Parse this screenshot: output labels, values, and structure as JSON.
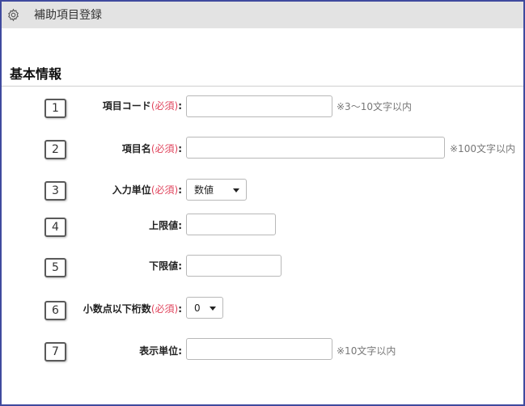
{
  "window": {
    "title": "補助項目登録",
    "settings_icon": "gear-icon"
  },
  "section": {
    "title": "基本情報"
  },
  "fields": [
    {
      "number": "1",
      "label": "項目コード",
      "required": "(必須)",
      "colon": ":",
      "value": "",
      "hint": "※3〜10文字以内"
    },
    {
      "number": "2",
      "label": "項目名",
      "required": "(必須)",
      "colon": ":",
      "value": "",
      "hint": "※100文字以内"
    },
    {
      "number": "3",
      "label": "入力単位",
      "required": "(必須)",
      "colon": ":",
      "value": "数値"
    },
    {
      "number": "4",
      "label": "上限値",
      "colon": ":",
      "value": ""
    },
    {
      "number": "5",
      "label": "下限値",
      "colon": ":",
      "value": ""
    },
    {
      "number": "6",
      "label": "小数点以下桁数",
      "required": "(必須)",
      "colon": ":",
      "value": "0"
    },
    {
      "number": "7",
      "label": "表示単位",
      "colon": ":",
      "value": "",
      "hint": "※10文字以内"
    }
  ],
  "colors": {
    "frame": "#3f4a9e",
    "titlebar": "#e3e3e3",
    "required": "#e0445c"
  }
}
